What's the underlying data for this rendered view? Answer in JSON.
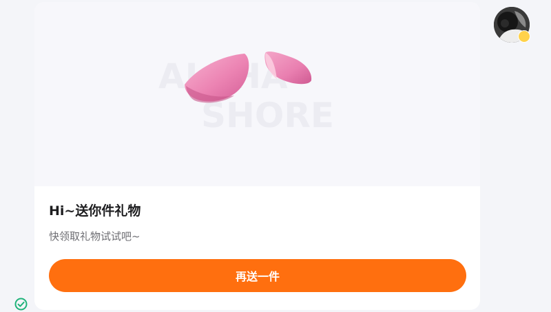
{
  "gift_card": {
    "watermark_line1": "ALPHA",
    "watermark_line2": "SHORE",
    "title": "Hi~送你件礼物",
    "subtitle": "快领取礼物试试吧~",
    "send_again_label": "再送一件"
  },
  "icons": {
    "status": "check-circle-icon",
    "avatar_badge": "emoji-badge-icon"
  },
  "colors": {
    "accent": "#ff6f0f",
    "status_check": "#1fb37a"
  }
}
